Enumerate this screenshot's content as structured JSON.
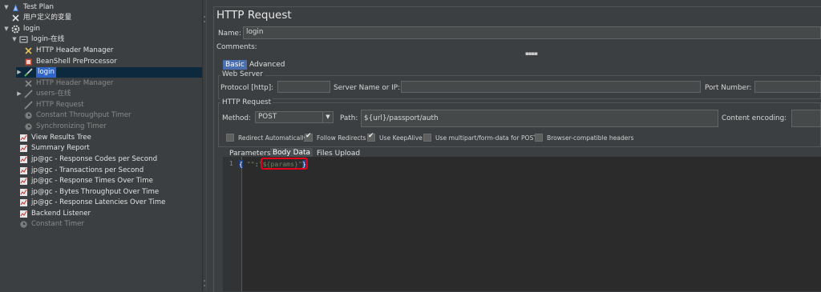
{
  "tree": {
    "items": [
      {
        "label": "Test Plan",
        "icon": "test-plan-icon",
        "twisty": "▼"
      },
      {
        "label": "用户定义的变量",
        "icon": "user-variables-icon",
        "twisty": ""
      },
      {
        "label": "login",
        "icon": "thread-group-icon",
        "twisty": "▼"
      },
      {
        "label": "login-在线",
        "icon": "controller-icon",
        "twisty": "▼"
      },
      {
        "label": "HTTP Header Manager",
        "icon": "header-manager-icon",
        "twisty": ""
      },
      {
        "label": "BeanShell PreProcessor",
        "icon": "preprocessor-icon",
        "twisty": ""
      },
      {
        "label": "login",
        "icon": "http-sampler-icon",
        "twisty": "▶"
      },
      {
        "label": "HTTP Header Manager",
        "icon": "header-manager-icon",
        "twisty": ""
      },
      {
        "label": "users-在线",
        "icon": "controller-icon",
        "twisty": "▶"
      },
      {
        "label": "HTTP Request",
        "icon": "http-sampler-icon",
        "twisty": ""
      },
      {
        "label": "Constant Throughput Timer",
        "icon": "timer-icon",
        "twisty": ""
      },
      {
        "label": "Synchronizing Timer",
        "icon": "timer-icon",
        "twisty": ""
      },
      {
        "label": "View Results Tree",
        "icon": "listener-icon",
        "twisty": ""
      },
      {
        "label": "Summary Report",
        "icon": "listener-icon",
        "twisty": ""
      },
      {
        "label": "jp@gc - Response Codes per Second",
        "icon": "listener-icon",
        "twisty": ""
      },
      {
        "label": "jp@gc - Transactions per Second",
        "icon": "listener-icon",
        "twisty": ""
      },
      {
        "label": "jp@gc - Response Times Over Time",
        "icon": "listener-icon",
        "twisty": ""
      },
      {
        "label": "jp@gc - Bytes Throughput Over Time",
        "icon": "listener-icon",
        "twisty": ""
      },
      {
        "label": "jp@gc - Response Latencies Over Time",
        "icon": "listener-icon",
        "twisty": ""
      },
      {
        "label": "Backend Listener",
        "icon": "listener-icon",
        "twisty": ""
      },
      {
        "label": "Constant Timer",
        "icon": "timer-icon",
        "twisty": ""
      }
    ]
  },
  "panel": {
    "title": "HTTP Request",
    "name_label": "Name:",
    "name_value": "login",
    "comments_label": "Comments:",
    "tabs": [
      "Basic",
      "Advanced"
    ],
    "web_server_title": "Web Server",
    "protocol_label": "Protocol [http]:",
    "protocol_value": "",
    "server_label": "Server Name or IP:",
    "server_value": "",
    "port_label": "Port Number:",
    "port_value": "",
    "http_request_title": "HTTP Request",
    "method_label": "Method:",
    "method_value": "POST",
    "path_label": "Path:",
    "path_value": "${url}/passport/auth",
    "encoding_label": "Content encoding:",
    "encoding_value": "",
    "checkboxes": [
      {
        "label": "Redirect Automatically",
        "checked": false
      },
      {
        "label": "Follow Redirects",
        "checked": true
      },
      {
        "label": "Use KeepAlive",
        "checked": true
      },
      {
        "label": "Use multipart/form-data for POST",
        "checked": false
      },
      {
        "label": "Browser-compatible headers",
        "checked": false
      }
    ],
    "subtabs": [
      "Parameters",
      "Body Data",
      "Files Upload"
    ],
    "editor": {
      "line_number": "1",
      "open_brace": "{",
      "key": "\"\"",
      "colon": ":",
      "value": "\"${params}\"",
      "close_brace": "}"
    }
  }
}
